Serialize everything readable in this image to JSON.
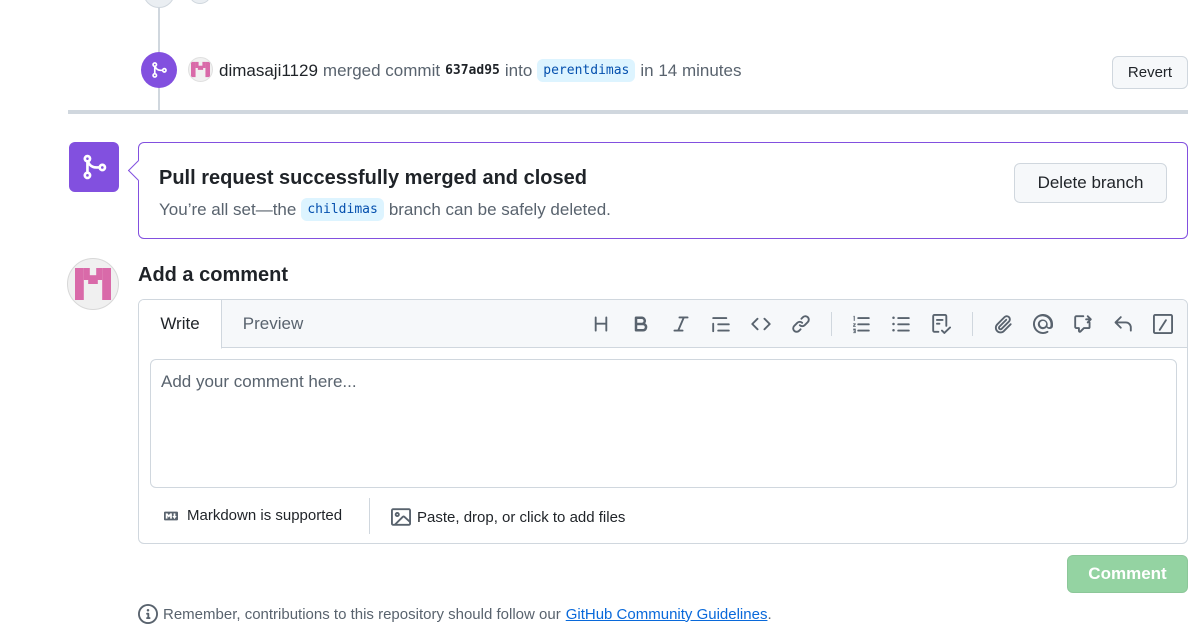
{
  "timeline_event": {
    "user": "dimasaji1129",
    "action": "merged commit",
    "commit_sha": "637ad95",
    "into_label": "into",
    "target_branch": "perentdimas",
    "time": "in 14 minutes",
    "revert_label": "Revert"
  },
  "merge_status": {
    "title": "Pull request successfully merged and closed",
    "sub_prefix": "You’re all set—the",
    "branch": "childimas",
    "sub_suffix": "branch can be safely deleted.",
    "delete_label": "Delete branch"
  },
  "comment": {
    "heading": "Add a comment",
    "tabs": {
      "write": "Write",
      "preview": "Preview"
    },
    "placeholder": "Add your comment here...",
    "markdown_note": "Markdown is supported",
    "attach_note": "Paste, drop, or click to add files",
    "submit_label": "Comment"
  },
  "guidelines": {
    "prefix": "Remember, contributions to this repository should follow our",
    "link": "GitHub Community Guidelines",
    "suffix": "."
  },
  "toolbar_icons": [
    "heading-icon",
    "bold-icon",
    "italic-icon",
    "quote-icon",
    "code-icon",
    "link-icon",
    "numbered-list-icon",
    "unordered-list-icon",
    "task-list-icon",
    "attach-icon",
    "mention-icon",
    "reference-icon",
    "reply-icon",
    "slash-command-icon"
  ],
  "colors": {
    "merged": "#8250df",
    "link": "#0969da",
    "comment_button": "#94d3a2",
    "branch_bg": "#ddf4ff"
  }
}
